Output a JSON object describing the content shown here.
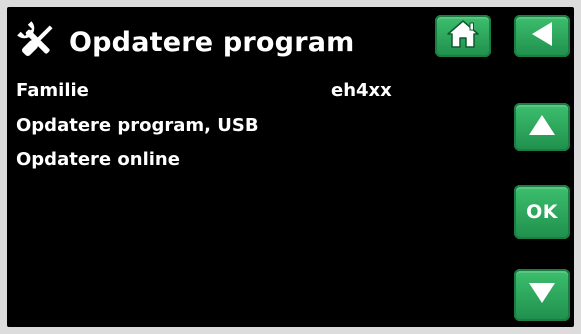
{
  "header": {
    "title": "Opdatere program",
    "icon": "tools-icon"
  },
  "rows": [
    {
      "label": "Familie",
      "value": "eh4xx"
    },
    {
      "label": "Opdatere program, USB"
    },
    {
      "label": "Opdatere online"
    }
  ],
  "buttons": {
    "home_icon": "home-icon",
    "back_icon": "back-arrow-icon",
    "up_icon": "arrow-up-icon",
    "ok_label": "OK",
    "down_icon": "arrow-down-icon"
  },
  "colors": {
    "screen_background": "#000000",
    "button_green": "#2aa35a",
    "text": "#ffffff"
  }
}
